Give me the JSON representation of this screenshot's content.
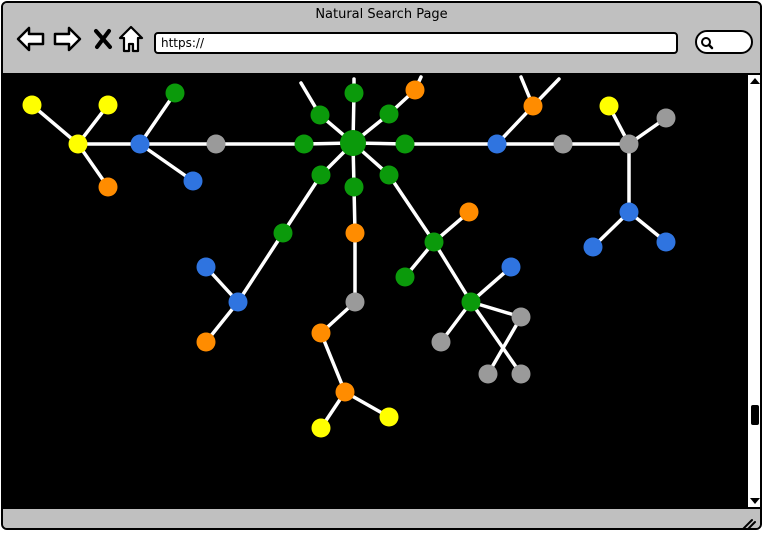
{
  "window": {
    "title": "Natural Search Page"
  },
  "toolbar": {
    "back_icon": "back-arrow-icon",
    "forward_icon": "forward-arrow-icon",
    "stop_icon": "close-icon",
    "home_icon": "home-icon"
  },
  "address": {
    "url": "https://"
  },
  "search": {
    "icon": "search-icon"
  },
  "colors": {
    "green": "#0b9a0b",
    "blue": "#2f74e0",
    "orange": "#ff8c00",
    "gray": "#9a9a9a",
    "yellow": "#ffff00",
    "edge": "#ffffff",
    "background": "#000000"
  }
}
